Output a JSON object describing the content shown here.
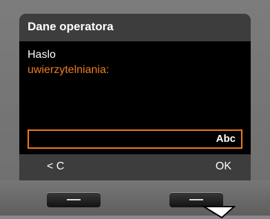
{
  "header": {
    "title": "Dane operatora"
  },
  "form": {
    "label_line1": "Haslo",
    "label_line2": "uwierzytelniania:",
    "input_value": "",
    "input_mode": "Abc"
  },
  "softkeys": {
    "left_label": "< C",
    "right_label": "OK"
  },
  "colors": {
    "accent": "#f07c1e",
    "bar": "#3d3d3d",
    "screen": "#000000"
  },
  "icons": {
    "pointer": "arrow-pointer-icon"
  }
}
